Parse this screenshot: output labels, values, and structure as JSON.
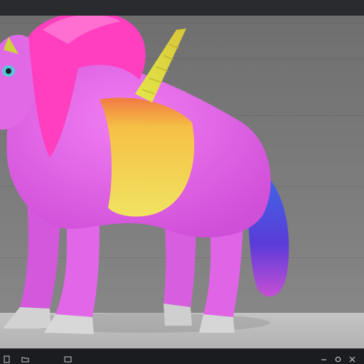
{
  "viewport": {
    "background_color": "#7c7c7c",
    "floor_color": "#bdbdbd",
    "subject_colors": {
      "fur": "#e561e8",
      "mane": "#ff4fbf",
      "belly": "#f2e04a",
      "horn": "#d9d936",
      "tail": "#3b57d8",
      "hoof": "#d0d0d0"
    }
  },
  "bottom_toolbar": {
    "left_icons": [
      "file-icon",
      "folder-icon"
    ],
    "right_icons": [
      "minus-icon",
      "settings-icon",
      "close-icon"
    ]
  }
}
